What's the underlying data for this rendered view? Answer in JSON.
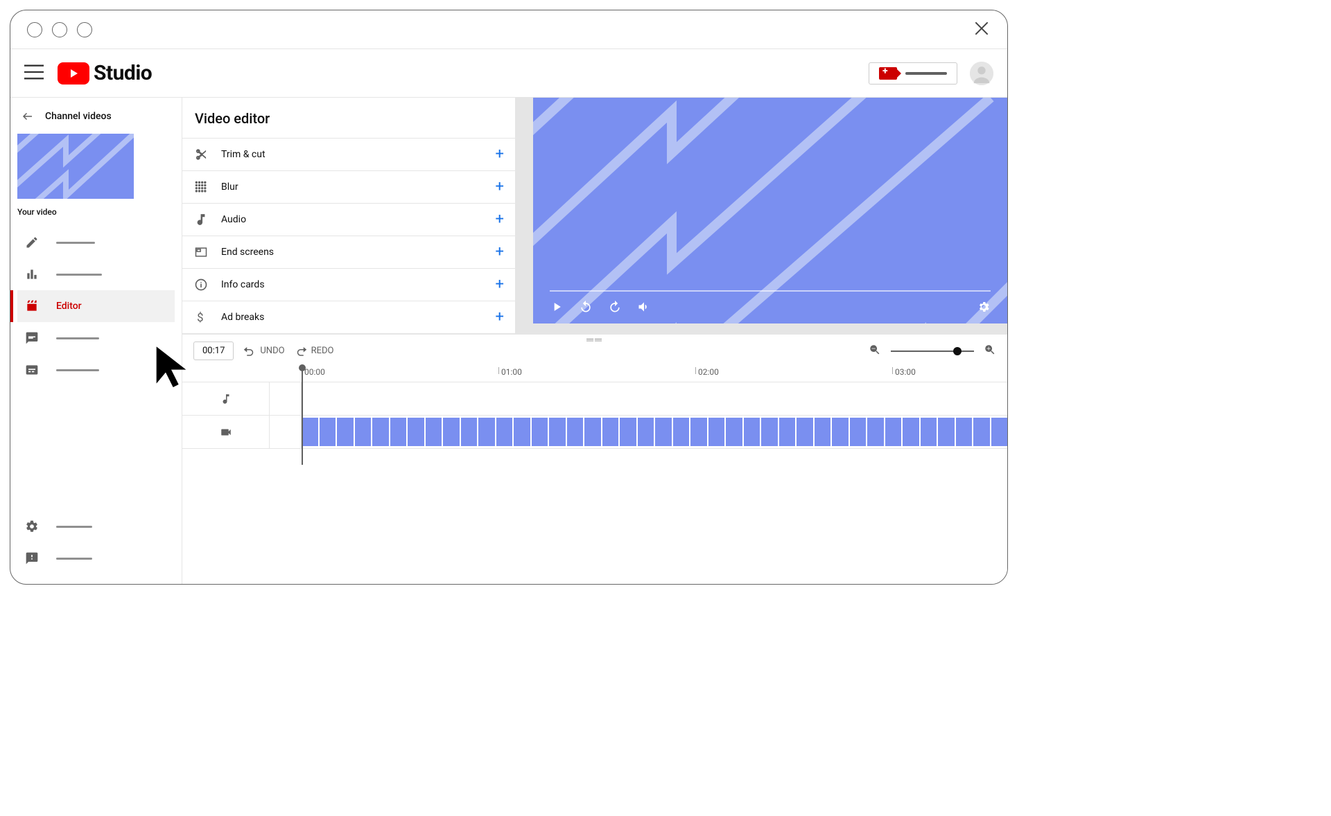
{
  "header": {
    "brand": "Studio"
  },
  "sidebar": {
    "back_label": "Channel videos",
    "your_video_label": "Your video",
    "active_item_label": "Editor"
  },
  "editor": {
    "title": "Video editor",
    "tools": {
      "trim": "Trim & cut",
      "blur": "Blur",
      "audio": "Audio",
      "end_screens": "End screens",
      "info_cards": "Info cards",
      "ad_breaks": "Ad breaks"
    }
  },
  "timeline": {
    "timecode": "00:17",
    "undo_label": "UNDO",
    "redo_label": "REDO",
    "marks": [
      "00:00",
      "01:00",
      "02:00",
      "03:00"
    ]
  }
}
